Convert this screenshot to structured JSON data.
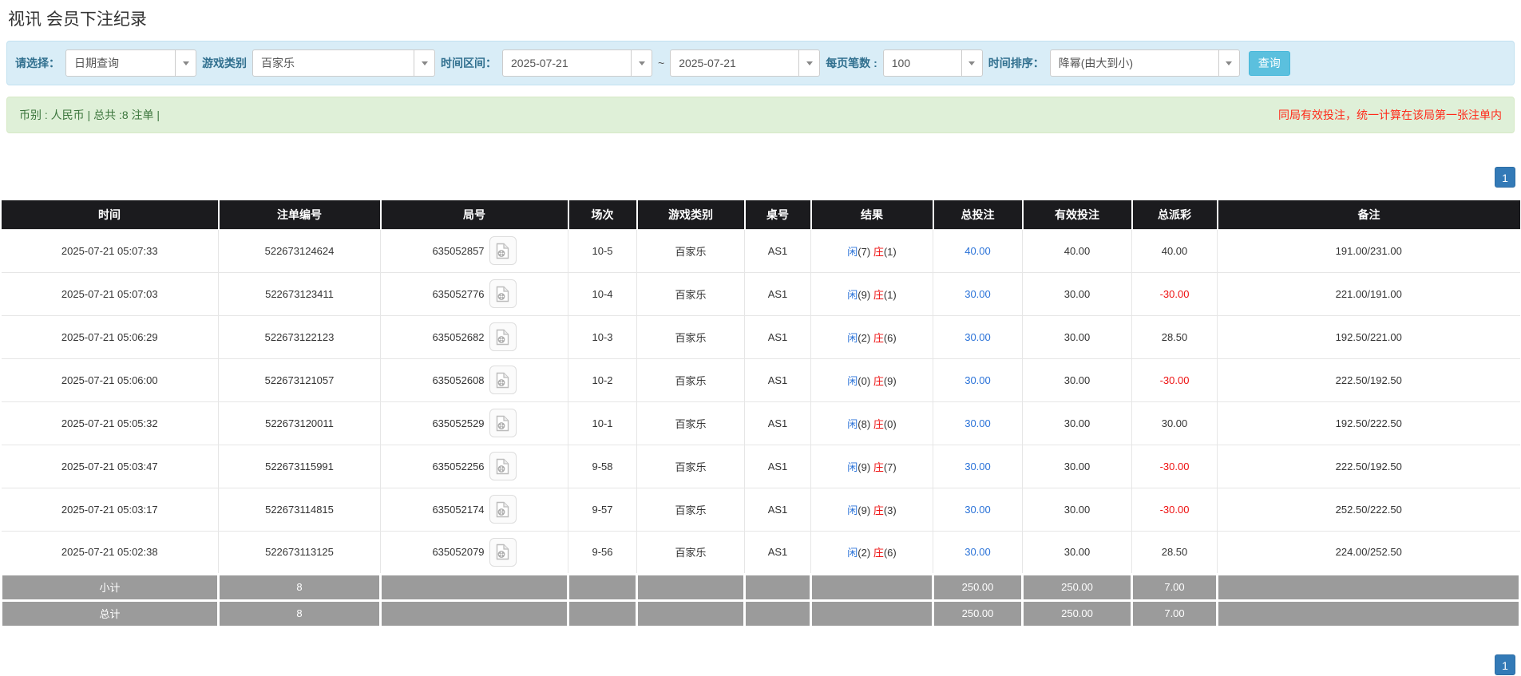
{
  "page": {
    "title": "视讯 会员下注纪录"
  },
  "filters": {
    "select_label": "请选择：",
    "select_value": "日期查询",
    "game_type_label": "游戏类别",
    "game_type_value": "百家乐",
    "date_range_label": "时间区间：",
    "date_from": "2025-07-21",
    "date_separator": "~",
    "date_to": "2025-07-21",
    "page_size_label": "每页笔数 :",
    "page_size_value": "100",
    "sort_label": "时间排序：",
    "sort_value": "降幂(由大到小)",
    "search_button": "查询"
  },
  "summary": {
    "left": "币别 : 人民币 | 总共 :8 注单 |",
    "right_notice": "同局有效投注，统一计算在该局第一张注单内"
  },
  "pagination": {
    "current": "1"
  },
  "table": {
    "headers": [
      "时间",
      "注单编号",
      "局号",
      "场次",
      "游戏类别",
      "桌号",
      "结果",
      "总投注",
      "有效投注",
      "总派彩",
      "备注"
    ],
    "rows": [
      {
        "time": "2025-07-21 05:07:33",
        "bet_id": "522673124624",
        "round_id": "635052857",
        "session": "10-5",
        "game": "百家乐",
        "table_no": "AS1",
        "player": "闲",
        "player_count": "(7)",
        "banker": "庄",
        "banker_count": "(1)",
        "total_bet": "40.00",
        "valid_bet": "40.00",
        "payout": "40.00",
        "remark": "191.00/231.00"
      },
      {
        "time": "2025-07-21 05:07:03",
        "bet_id": "522673123411",
        "round_id": "635052776",
        "session": "10-4",
        "game": "百家乐",
        "table_no": "AS1",
        "player": "闲",
        "player_count": "(9)",
        "banker": "庄",
        "banker_count": "(1)",
        "total_bet": "30.00",
        "valid_bet": "30.00",
        "payout": "-30.00",
        "remark": "221.00/191.00"
      },
      {
        "time": "2025-07-21 05:06:29",
        "bet_id": "522673122123",
        "round_id": "635052682",
        "session": "10-3",
        "game": "百家乐",
        "table_no": "AS1",
        "player": "闲",
        "player_count": "(2)",
        "banker": "庄",
        "banker_count": "(6)",
        "total_bet": "30.00",
        "valid_bet": "30.00",
        "payout": "28.50",
        "remark": "192.50/221.00"
      },
      {
        "time": "2025-07-21 05:06:00",
        "bet_id": "522673121057",
        "round_id": "635052608",
        "session": "10-2",
        "game": "百家乐",
        "table_no": "AS1",
        "player": "闲",
        "player_count": "(0)",
        "banker": "庄",
        "banker_count": "(9)",
        "total_bet": "30.00",
        "valid_bet": "30.00",
        "payout": "-30.00",
        "remark": "222.50/192.50"
      },
      {
        "time": "2025-07-21 05:05:32",
        "bet_id": "522673120011",
        "round_id": "635052529",
        "session": "10-1",
        "game": "百家乐",
        "table_no": "AS1",
        "player": "闲",
        "player_count": "(8)",
        "banker": "庄",
        "banker_count": "(0)",
        "total_bet": "30.00",
        "valid_bet": "30.00",
        "payout": "30.00",
        "remark": "192.50/222.50"
      },
      {
        "time": "2025-07-21 05:03:47",
        "bet_id": "522673115991",
        "round_id": "635052256",
        "session": "9-58",
        "game": "百家乐",
        "table_no": "AS1",
        "player": "闲",
        "player_count": "(9)",
        "banker": "庄",
        "banker_count": "(7)",
        "total_bet": "30.00",
        "valid_bet": "30.00",
        "payout": "-30.00",
        "remark": "222.50/192.50"
      },
      {
        "time": "2025-07-21 05:03:17",
        "bet_id": "522673114815",
        "round_id": "635052174",
        "session": "9-57",
        "game": "百家乐",
        "table_no": "AS1",
        "player": "闲",
        "player_count": "(9)",
        "banker": "庄",
        "banker_count": "(3)",
        "total_bet": "30.00",
        "valid_bet": "30.00",
        "payout": "-30.00",
        "remark": "252.50/222.50"
      },
      {
        "time": "2025-07-21 05:02:38",
        "bet_id": "522673113125",
        "round_id": "635052079",
        "session": "9-56",
        "game": "百家乐",
        "table_no": "AS1",
        "player": "闲",
        "player_count": "(2)",
        "banker": "庄",
        "banker_count": "(6)",
        "total_bet": "30.00",
        "valid_bet": "30.00",
        "payout": "28.50",
        "remark": "224.00/252.50"
      }
    ],
    "footer": [
      {
        "label": "小计",
        "count": "8",
        "total_bet": "250.00",
        "valid_bet": "250.00",
        "payout": "7.00"
      },
      {
        "label": "总计",
        "count": "8",
        "total_bet": "250.00",
        "valid_bet": "250.00",
        "payout": "7.00"
      }
    ]
  },
  "colors": {
    "accent_blue": "#2a72d8",
    "loss_red": "#ee1111",
    "notice_red": "#ff2a1a",
    "filter_bg": "#d9edf7",
    "summary_bg": "#dff0d8",
    "summary_text": "#3c763d",
    "header_bg": "#1b1b1e",
    "footer_bg": "#9b9b9b",
    "page_btn": "#337ab7",
    "btn_info": "#5bc0de"
  }
}
